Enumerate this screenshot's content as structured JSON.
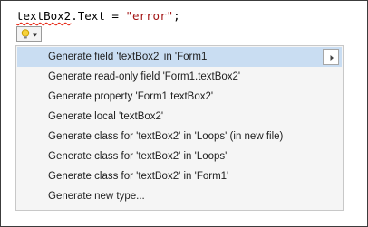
{
  "code": {
    "identifier": "textBox2",
    "rest": ".Text = ",
    "string_literal": "\"error\"",
    "terminator": ";"
  },
  "lightbulb": {
    "icon": "lightbulb-icon",
    "dropdown_icon": "chevron-down-icon"
  },
  "menu": {
    "items": [
      {
        "label": "Generate field 'textBox2' in 'Form1'"
      },
      {
        "label": "Generate read-only field 'Form1.textBox2'"
      },
      {
        "label": "Generate property 'Form1.textBox2'"
      },
      {
        "label": "Generate local 'textBox2'"
      },
      {
        "label": "Generate class for 'textBox2' in 'Loops' (in new file)"
      },
      {
        "label": "Generate class for 'textBox2' in 'Loops'"
      },
      {
        "label": "Generate class for 'textBox2' in 'Form1'"
      },
      {
        "label": "Generate new type..."
      }
    ],
    "selected_index": 0,
    "preview_arrow_icon": "chevron-right-icon"
  },
  "colors": {
    "selection": "#c9ddf2",
    "string": "#a31515",
    "error_squiggle": "#e51400"
  }
}
